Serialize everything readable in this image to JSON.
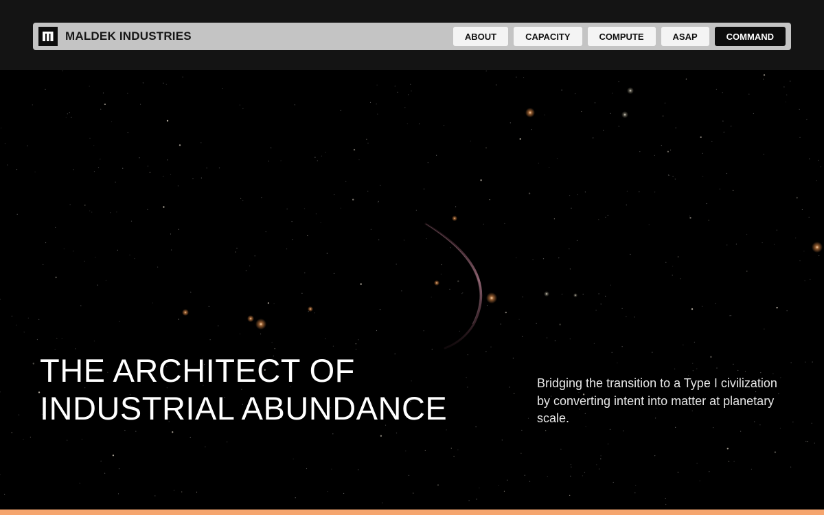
{
  "header": {
    "logo_icon": "maldek-logo-icon",
    "brand": "MALDEK INDUSTRIES",
    "nav": [
      {
        "label": "ABOUT"
      },
      {
        "label": "CAPACITY"
      },
      {
        "label": "COMPUTE"
      },
      {
        "label": "ASAP"
      },
      {
        "label": "COMMAND"
      }
    ]
  },
  "hero": {
    "title_line1": "THE ARCHITECT OF",
    "title_line2": "INDUSTRIAL ABUNDANCE",
    "subtitle": "Bridging the transition to a Type I civilization by converting intent into matter at planetary scale."
  },
  "colors": {
    "background": "#000000",
    "header_bg": "#141414",
    "nav_bg": "#c4c4c4",
    "nav_button": "#f4f4f4",
    "nav_button_primary": "#0d0d0d",
    "accent_bar": "#f5a56e",
    "planet_rim": "#8a5a6a"
  }
}
